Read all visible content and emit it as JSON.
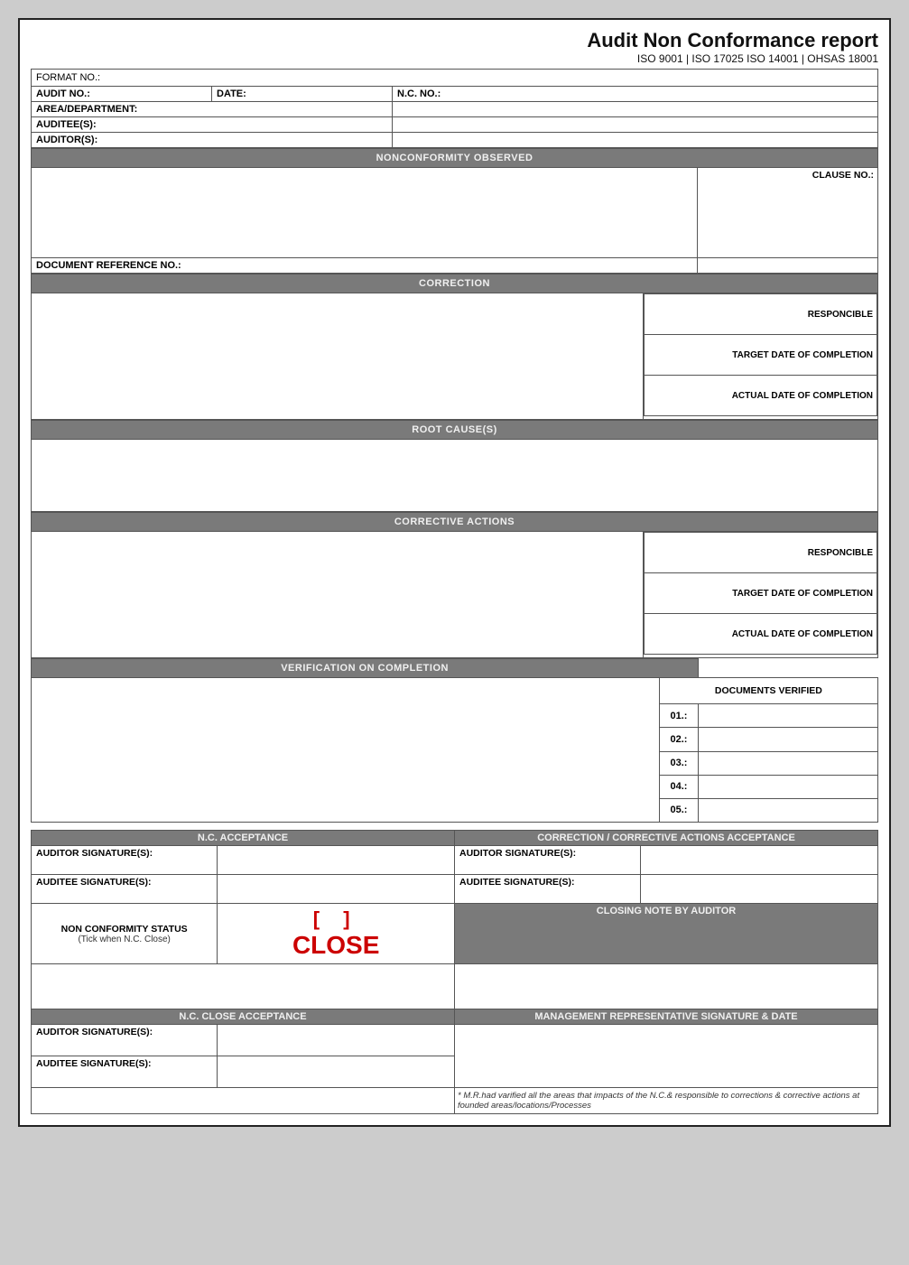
{
  "header": {
    "title": "Audit Non Conformance report",
    "subtitle": "ISO 9001 | ISO 17025 ISO 14001 | OHSAS 18001",
    "format_no_label": "FORMAT NO.:"
  },
  "info_rows": {
    "audit_no_label": "AUDIT NO.:",
    "date_label": "DATE:",
    "nc_no_label": "N.C. NO.:",
    "area_dept_label": "AREA/DEPARTMENT:",
    "auditees_label": "AUDITEE(S):",
    "auditors_label": "AUDITOR(S):"
  },
  "sections": {
    "nonconformity": "NONCONFORMITY OBSERVED",
    "clause_no_label": "CLAUSE NO.:",
    "doc_ref_label": "DOCUMENT REFERENCE NO.:",
    "correction": "CORRECTION",
    "responsible_label": "RESPONCIBLE",
    "target_date_label": "TARGET DATE OF COMPLETION",
    "actual_date_label": "ACTUAL DATE OF COMPLETION",
    "root_cause": "ROOT CAUSE(S)",
    "corrective_actions": "CORRECTIVE ACTIONS",
    "verification": "VERIFICATION ON COMPLETION",
    "documents_verified": "DOCUMENTS VERIFIED",
    "doc_nums": [
      "01.:",
      "02.:",
      "03.:",
      "04.:",
      "05.:"
    ]
  },
  "acceptance": {
    "nc_acceptance_label": "N.C. ACCEPTANCE",
    "cc_acceptance_label": "CORRECTION / CORRECTIVE ACTIONS ACCEPTANCE",
    "auditor_sig_label": "AUDITOR SIGNATURE(S):",
    "auditee_sig_label": "AUDITEE SIGNATURE(S):",
    "nc_status_label": "NON CONFORMITY STATUS",
    "nc_status_sub": "(Tick when N.C. Close)",
    "close_bracket": "[          ]",
    "close_text": "CLOSE",
    "closing_note_label": "CLOSING NOTE BY AUDITOR",
    "nc_close_acceptance_label": "N.C. CLOSE ACCEPTANCE",
    "mgmt_rep_label": "MANAGEMENT REPRESENTATIVE SIGNATURE & DATE",
    "auditor_sig2_label": "AUDITOR SIGNATURE(S):",
    "auditee_sig2_label": "AUDITEE SIGNATURE(S):",
    "footer_note": "* M.R.had varified all the areas that impacts of the N.C.& responsible to corrections & corrective actions at founded areas/locations/Processes"
  }
}
